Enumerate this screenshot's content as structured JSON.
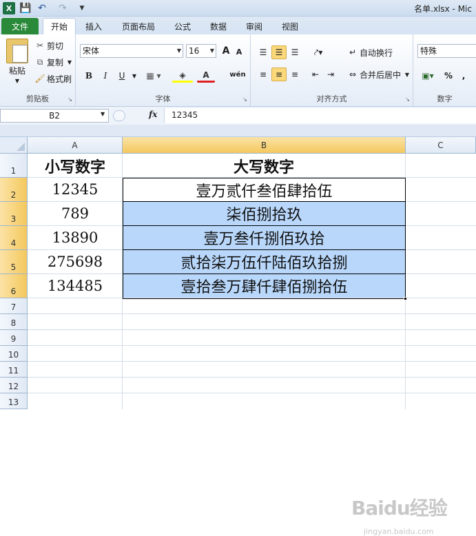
{
  "window": {
    "title": "名单.xlsx - Mic"
  },
  "tabs": {
    "file": "文件",
    "items": [
      "开始",
      "插入",
      "页面布局",
      "公式",
      "数据",
      "审阅",
      "视图"
    ]
  },
  "ribbon": {
    "clipboard": {
      "paste": "粘贴",
      "cut": "剪切",
      "copy": "复制",
      "format_painter": "格式刷",
      "label": "剪贴板"
    },
    "font": {
      "name": "宋体",
      "size": "16",
      "label": "字体",
      "bold": "B",
      "italic": "I",
      "underline": "U",
      "grow": "A",
      "shrink": "A",
      "font_color": "A",
      "phonetic": "wén"
    },
    "alignment": {
      "wrap": "自动换行",
      "merge": "合并后居中",
      "label": "对齐方式"
    },
    "number": {
      "format": "特殊",
      "percent": "%",
      "comma": ",",
      "label": "数字"
    }
  },
  "formula": {
    "cell_ref": "B2",
    "fx": "fx",
    "value": "12345"
  },
  "columns": [
    "A",
    "B",
    "C"
  ],
  "rows": [
    "1",
    "2",
    "3",
    "4",
    "5",
    "6",
    "7",
    "8",
    "9",
    "10",
    "11",
    "12",
    "13"
  ],
  "sheet": {
    "header": {
      "a": "小写数字",
      "b": "大写数字"
    },
    "data": [
      {
        "a": "12345",
        "b": "壹万贰仟叁佰肆拾伍"
      },
      {
        "a": "789",
        "b": "柒佰捌拾玖"
      },
      {
        "a": "13890",
        "b": "壹万叁仟捌佰玖拾"
      },
      {
        "a": "275698",
        "b": "贰拾柒万伍仟陆佰玖拾捌"
      },
      {
        "a": "134485",
        "b": "壹拾叁万肆仟肆佰捌拾伍"
      }
    ]
  },
  "watermark": {
    "main": "Baidu经验",
    "sub": "jingyan.baidu.com"
  },
  "colors": {
    "selection_fill": "#b8d7fb",
    "header_highlight": "#f4c85d",
    "file_tab": "#2a8a3a"
  }
}
